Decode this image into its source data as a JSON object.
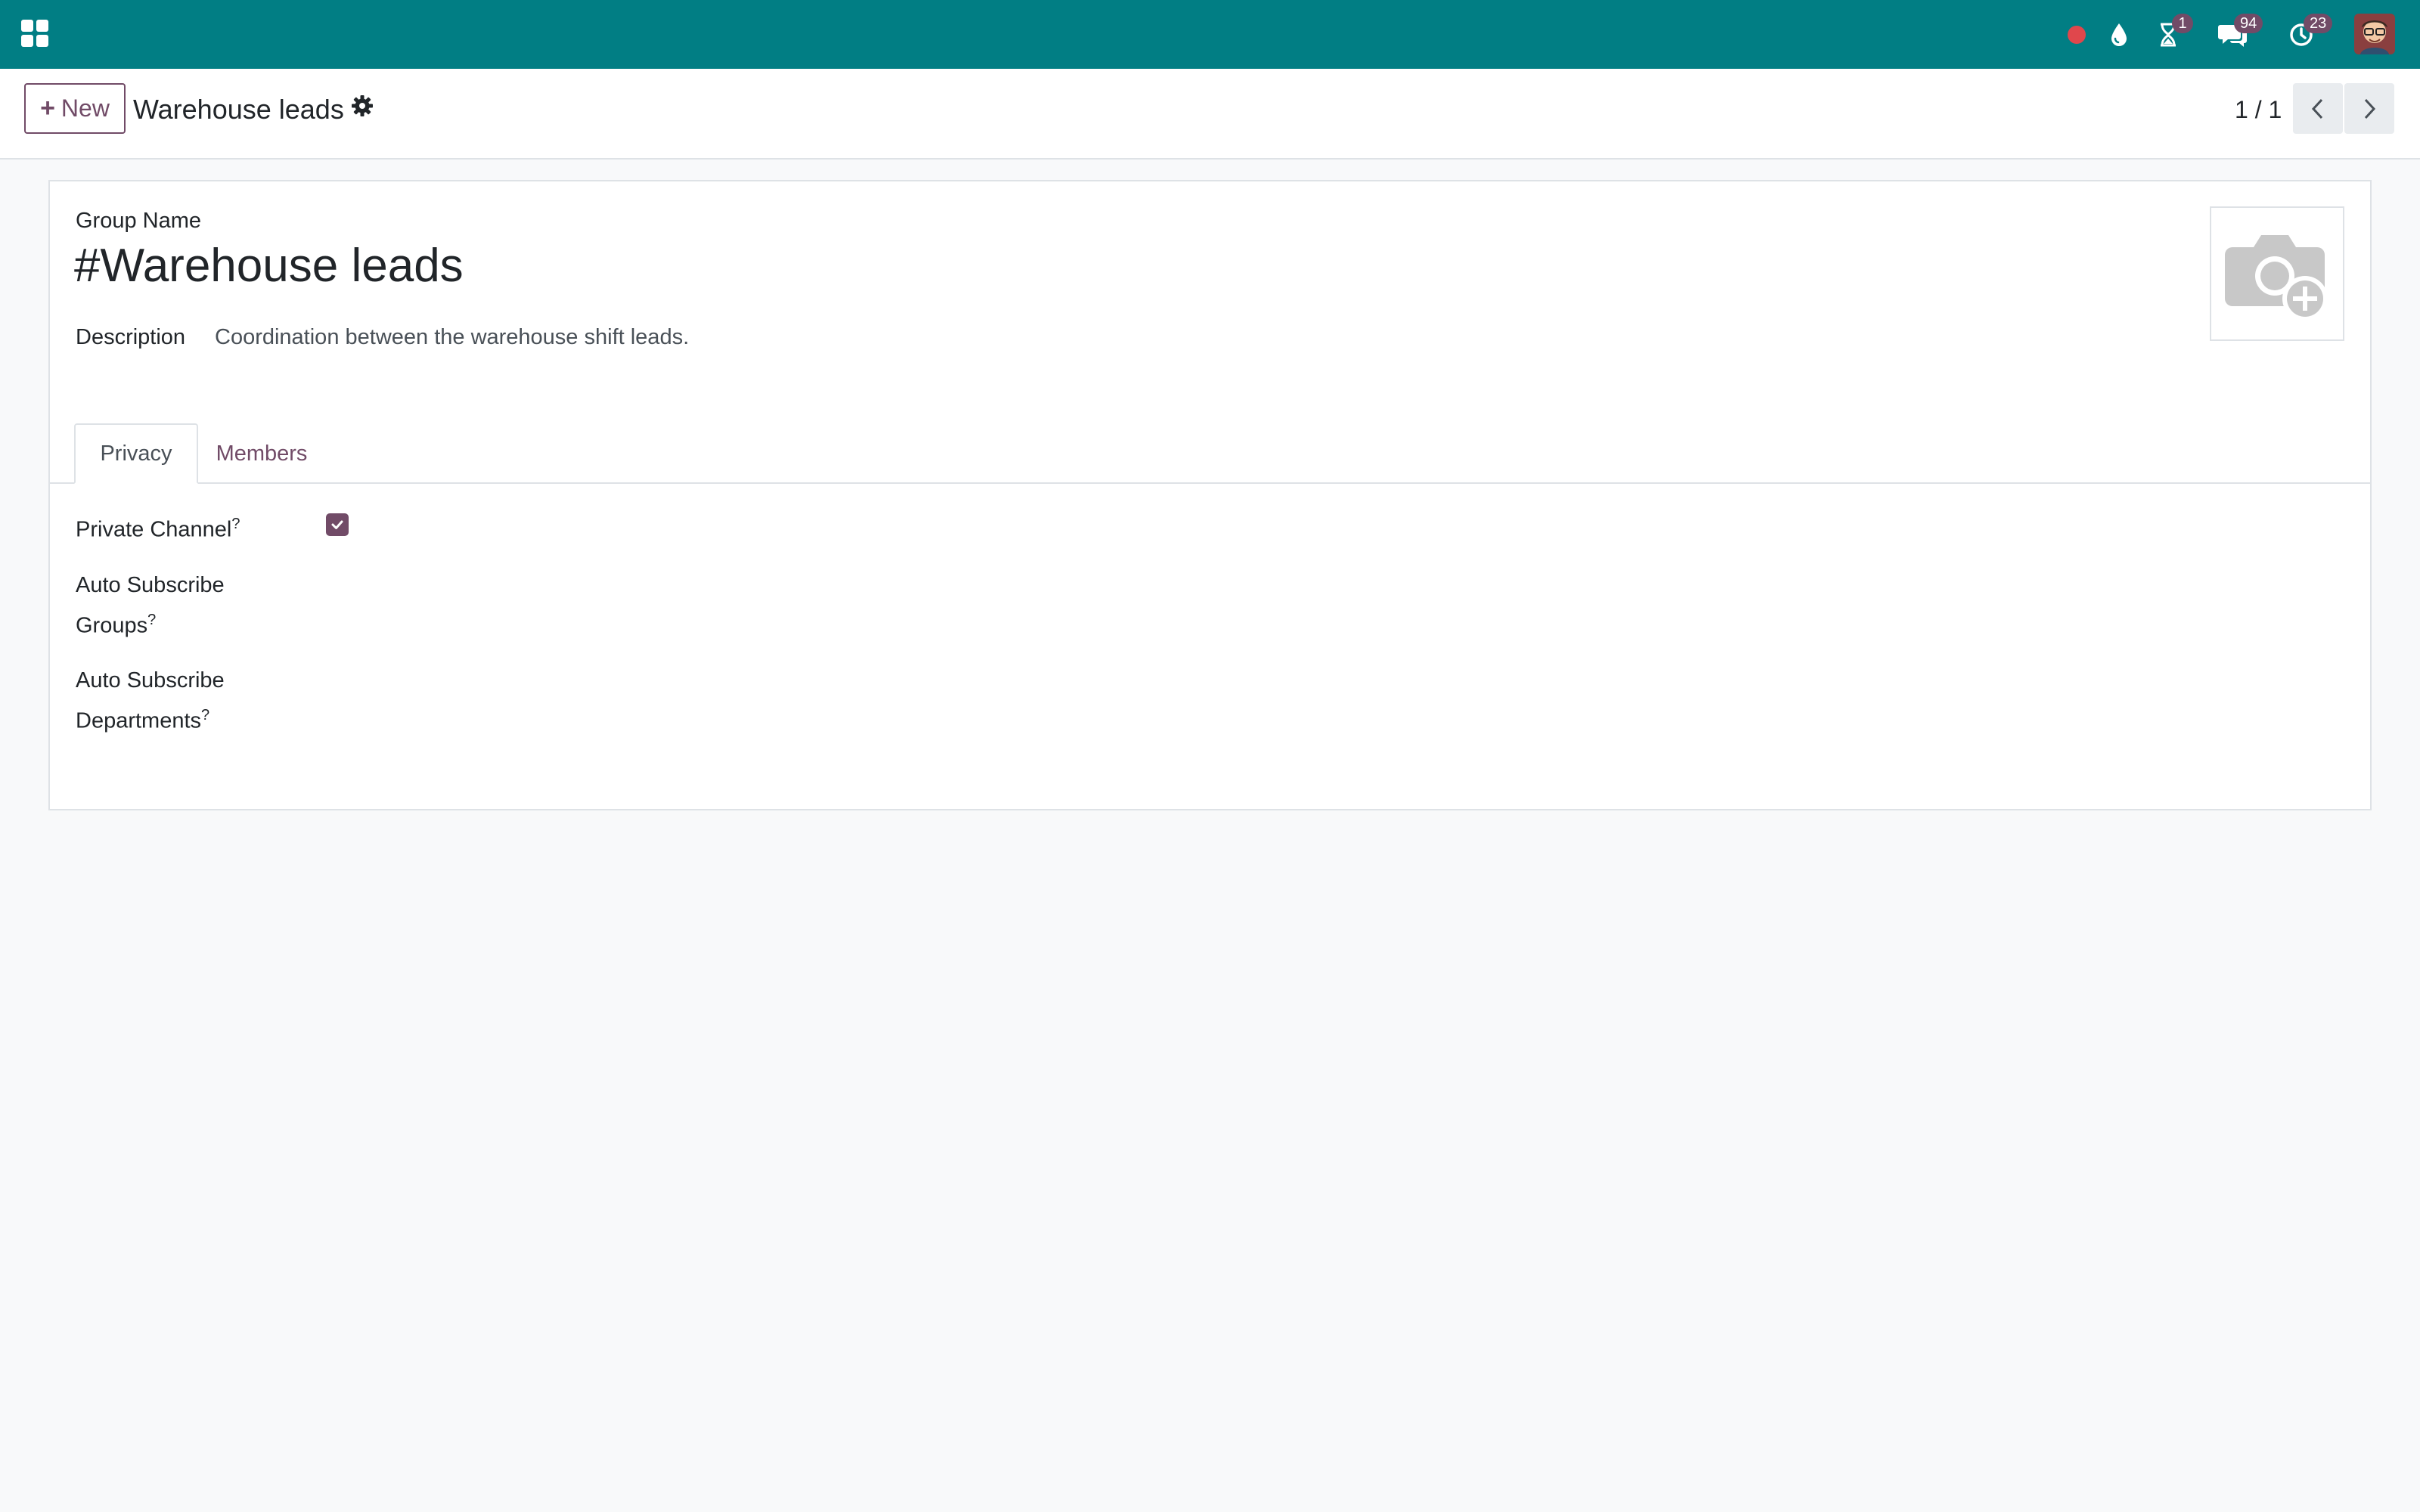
{
  "navbar": {
    "apps_icon": "apps-grid-icon",
    "systray": {
      "recording": {
        "icon": "record-dot-icon",
        "color": "#e0474c"
      },
      "droplet": {
        "icon": "droplet-icon"
      },
      "activities": {
        "icon": "hourglass-icon",
        "count": "1"
      },
      "messages": {
        "icon": "chat-bubbles-icon",
        "count": "94"
      },
      "clock": {
        "icon": "clock-icon",
        "count": "23"
      }
    },
    "avatar": "user-avatar"
  },
  "control_panel": {
    "new_button_label": "New",
    "breadcrumb_title": "Warehouse leads",
    "pager_value": "1 / 1"
  },
  "form": {
    "group_name_label": "Group Name",
    "group_name_value": "#Warehouse leads",
    "description_label": "Description",
    "description_value": "Coordination between the warehouse shift leads.",
    "tabs": [
      {
        "label": "Privacy",
        "active": true
      },
      {
        "label": "Members",
        "active": false
      }
    ],
    "privacy": {
      "private_channel_label": "Private Channel",
      "private_channel_checked": true,
      "auto_subscribe_groups_label_1": "Auto Subscribe",
      "auto_subscribe_groups_label_2": "Groups",
      "auto_subscribe_departments_label_1": "Auto Subscribe",
      "auto_subscribe_departments_label_2": "Departments",
      "help_mark": "?"
    }
  },
  "colors": {
    "navbar": "#017e84",
    "brand": "#714b67",
    "background": "#f8f9fa"
  }
}
